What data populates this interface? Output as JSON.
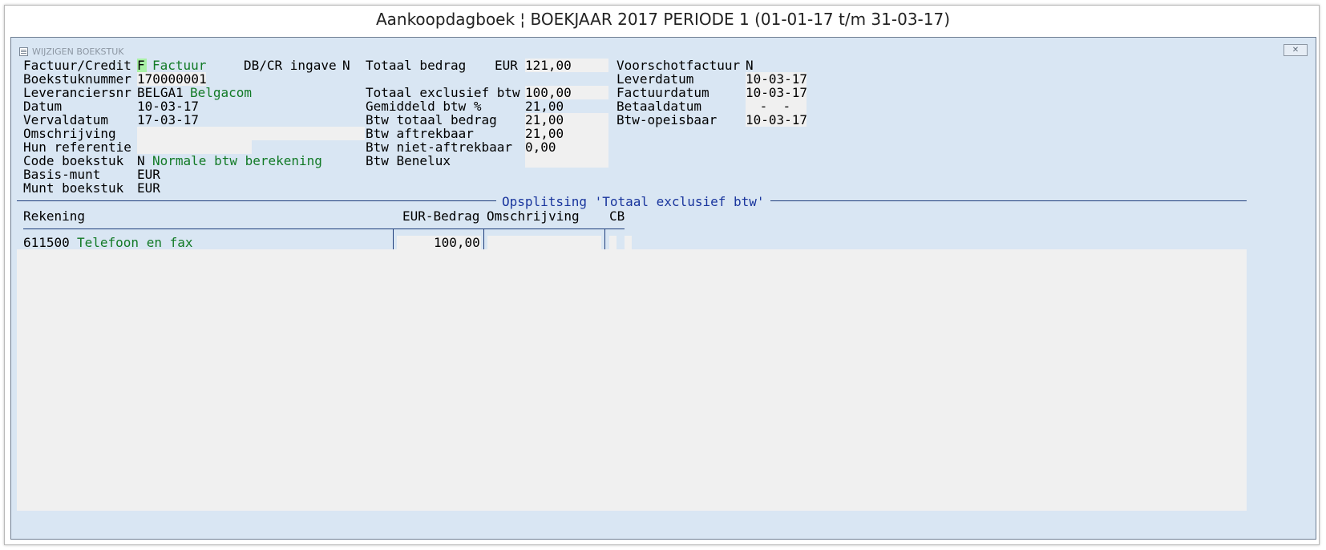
{
  "window_title": "Aankoopdagboek ¦ BOEKJAAR 2017 PERIODE 1 (01-01-17 t/m 31-03-17)",
  "dialog": {
    "caption": "WIJZIGEN BOEKSTUK",
    "close_label": "✕"
  },
  "col1": {
    "factuur_credit": {
      "label": "Factuur/Credit",
      "code": "F",
      "desc": "Factuur"
    },
    "dbcr": {
      "label": "DB/CR ingave",
      "value": "N"
    },
    "boekstuknummer": {
      "label": "Boekstuknummer",
      "value": "170000001"
    },
    "leveranciersnr": {
      "label": "Leveranciersnr",
      "value": "BELGA1",
      "desc": "Belgacom"
    },
    "datum": {
      "label": "Datum",
      "value": "10-03-17"
    },
    "vervaldatum": {
      "label": "Vervaldatum",
      "value": "17-03-17"
    },
    "omschrijving": {
      "label": "Omschrijving",
      "value": ""
    },
    "hun_referentie": {
      "label": "Hun referentie",
      "value": ""
    },
    "code_boekstuk": {
      "label": "Code boekstuk",
      "value": "N",
      "desc": "Normale btw berekening"
    },
    "basis_munt": {
      "label": "Basis-munt",
      "value": "EUR"
    },
    "munt_boekstuk": {
      "label": "Munt boekstuk",
      "value": "EUR"
    }
  },
  "col2": {
    "totaal_bedrag": {
      "label": "Totaal bedrag",
      "currency": "EUR",
      "value": "121,00"
    },
    "totaal_excl": {
      "label": "Totaal exclusief btw",
      "value": "100,00"
    },
    "gem_btw": {
      "label": "Gemiddeld btw %",
      "value": "21,00"
    },
    "btw_totaal": {
      "label": "Btw totaal bedrag",
      "value": "21,00"
    },
    "btw_aftrekbaar": {
      "label": "Btw aftrekbaar",
      "value": "21,00"
    },
    "btw_niet_aftrekbaar": {
      "label": "Btw niet-aftrekbaar",
      "value": "0,00"
    },
    "btw_benelux": {
      "label": "Btw Benelux",
      "value": ""
    }
  },
  "col3": {
    "voorschotfactuur": {
      "label": "Voorschotfactuur",
      "value": "N"
    },
    "leverdatum": {
      "label": "Leverdatum",
      "value": "10-03-17"
    },
    "factuurdatum": {
      "label": "Factuurdatum",
      "value": "10-03-17"
    },
    "betaaldatum": {
      "label": "Betaaldatum",
      "value": " -  -"
    },
    "btw_opeisbaar": {
      "label": "Btw-opeisbaar",
      "value": "10-03-17"
    }
  },
  "split": {
    "title": "Opsplitsing 'Totaal exclusief btw'",
    "headers": {
      "rekening": "Rekening",
      "bedrag": "EUR-Bedrag",
      "omschrijving": "Omschrijving",
      "cb": "CB"
    },
    "rows": [
      {
        "rekening": "611500",
        "naam": "Telefoon en fax",
        "bedrag": "100,00",
        "omschrijving": "",
        "cb": ""
      }
    ]
  }
}
